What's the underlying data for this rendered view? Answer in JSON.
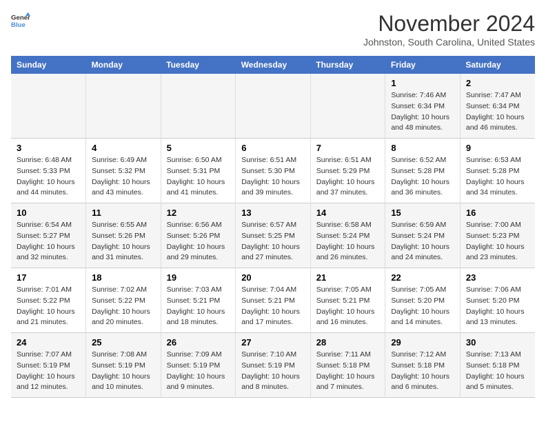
{
  "header": {
    "logo_line1": "General",
    "logo_line2": "Blue",
    "month": "November 2024",
    "location": "Johnston, South Carolina, United States"
  },
  "weekdays": [
    "Sunday",
    "Monday",
    "Tuesday",
    "Wednesday",
    "Thursday",
    "Friday",
    "Saturday"
  ],
  "weeks": [
    [
      {
        "day": "",
        "info": ""
      },
      {
        "day": "",
        "info": ""
      },
      {
        "day": "",
        "info": ""
      },
      {
        "day": "",
        "info": ""
      },
      {
        "day": "",
        "info": ""
      },
      {
        "day": "1",
        "info": "Sunrise: 7:46 AM\nSunset: 6:34 PM\nDaylight: 10 hours\nand 48 minutes."
      },
      {
        "day": "2",
        "info": "Sunrise: 7:47 AM\nSunset: 6:34 PM\nDaylight: 10 hours\nand 46 minutes."
      }
    ],
    [
      {
        "day": "3",
        "info": "Sunrise: 6:48 AM\nSunset: 5:33 PM\nDaylight: 10 hours\nand 44 minutes."
      },
      {
        "day": "4",
        "info": "Sunrise: 6:49 AM\nSunset: 5:32 PM\nDaylight: 10 hours\nand 43 minutes."
      },
      {
        "day": "5",
        "info": "Sunrise: 6:50 AM\nSunset: 5:31 PM\nDaylight: 10 hours\nand 41 minutes."
      },
      {
        "day": "6",
        "info": "Sunrise: 6:51 AM\nSunset: 5:30 PM\nDaylight: 10 hours\nand 39 minutes."
      },
      {
        "day": "7",
        "info": "Sunrise: 6:51 AM\nSunset: 5:29 PM\nDaylight: 10 hours\nand 37 minutes."
      },
      {
        "day": "8",
        "info": "Sunrise: 6:52 AM\nSunset: 5:28 PM\nDaylight: 10 hours\nand 36 minutes."
      },
      {
        "day": "9",
        "info": "Sunrise: 6:53 AM\nSunset: 5:28 PM\nDaylight: 10 hours\nand 34 minutes."
      }
    ],
    [
      {
        "day": "10",
        "info": "Sunrise: 6:54 AM\nSunset: 5:27 PM\nDaylight: 10 hours\nand 32 minutes."
      },
      {
        "day": "11",
        "info": "Sunrise: 6:55 AM\nSunset: 5:26 PM\nDaylight: 10 hours\nand 31 minutes."
      },
      {
        "day": "12",
        "info": "Sunrise: 6:56 AM\nSunset: 5:26 PM\nDaylight: 10 hours\nand 29 minutes."
      },
      {
        "day": "13",
        "info": "Sunrise: 6:57 AM\nSunset: 5:25 PM\nDaylight: 10 hours\nand 27 minutes."
      },
      {
        "day": "14",
        "info": "Sunrise: 6:58 AM\nSunset: 5:24 PM\nDaylight: 10 hours\nand 26 minutes."
      },
      {
        "day": "15",
        "info": "Sunrise: 6:59 AM\nSunset: 5:24 PM\nDaylight: 10 hours\nand 24 minutes."
      },
      {
        "day": "16",
        "info": "Sunrise: 7:00 AM\nSunset: 5:23 PM\nDaylight: 10 hours\nand 23 minutes."
      }
    ],
    [
      {
        "day": "17",
        "info": "Sunrise: 7:01 AM\nSunset: 5:22 PM\nDaylight: 10 hours\nand 21 minutes."
      },
      {
        "day": "18",
        "info": "Sunrise: 7:02 AM\nSunset: 5:22 PM\nDaylight: 10 hours\nand 20 minutes."
      },
      {
        "day": "19",
        "info": "Sunrise: 7:03 AM\nSunset: 5:21 PM\nDaylight: 10 hours\nand 18 minutes."
      },
      {
        "day": "20",
        "info": "Sunrise: 7:04 AM\nSunset: 5:21 PM\nDaylight: 10 hours\nand 17 minutes."
      },
      {
        "day": "21",
        "info": "Sunrise: 7:05 AM\nSunset: 5:21 PM\nDaylight: 10 hours\nand 16 minutes."
      },
      {
        "day": "22",
        "info": "Sunrise: 7:05 AM\nSunset: 5:20 PM\nDaylight: 10 hours\nand 14 minutes."
      },
      {
        "day": "23",
        "info": "Sunrise: 7:06 AM\nSunset: 5:20 PM\nDaylight: 10 hours\nand 13 minutes."
      }
    ],
    [
      {
        "day": "24",
        "info": "Sunrise: 7:07 AM\nSunset: 5:19 PM\nDaylight: 10 hours\nand 12 minutes."
      },
      {
        "day": "25",
        "info": "Sunrise: 7:08 AM\nSunset: 5:19 PM\nDaylight: 10 hours\nand 10 minutes."
      },
      {
        "day": "26",
        "info": "Sunrise: 7:09 AM\nSunset: 5:19 PM\nDaylight: 10 hours\nand 9 minutes."
      },
      {
        "day": "27",
        "info": "Sunrise: 7:10 AM\nSunset: 5:19 PM\nDaylight: 10 hours\nand 8 minutes."
      },
      {
        "day": "28",
        "info": "Sunrise: 7:11 AM\nSunset: 5:18 PM\nDaylight: 10 hours\nand 7 minutes."
      },
      {
        "day": "29",
        "info": "Sunrise: 7:12 AM\nSunset: 5:18 PM\nDaylight: 10 hours\nand 6 minutes."
      },
      {
        "day": "30",
        "info": "Sunrise: 7:13 AM\nSunset: 5:18 PM\nDaylight: 10 hours\nand 5 minutes."
      }
    ]
  ]
}
